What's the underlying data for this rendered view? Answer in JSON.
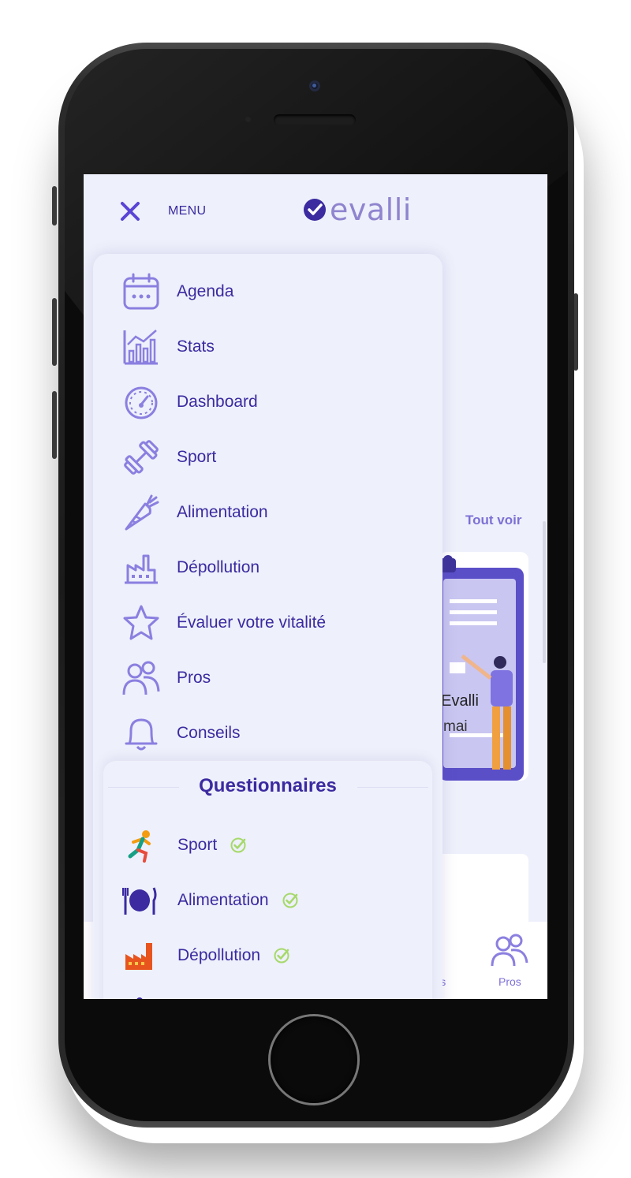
{
  "header": {
    "menu_label": "MENU",
    "logo_text": "evalli"
  },
  "menu": {
    "items": [
      {
        "label": "Agenda",
        "icon": "calendar-icon"
      },
      {
        "label": "Stats",
        "icon": "stats-chart-icon"
      },
      {
        "label": "Dashboard",
        "icon": "gauge-icon"
      },
      {
        "label": "Sport",
        "icon": "dumbbell-icon"
      },
      {
        "label": "Alimentation",
        "icon": "carrot-icon"
      },
      {
        "label": "Dépollution",
        "icon": "factory-icon"
      },
      {
        "label": "Évaluer votre vitalité",
        "icon": "star-icon"
      },
      {
        "label": "Pros",
        "icon": "users-icon"
      },
      {
        "label": "Conseils",
        "icon": "bell-icon"
      }
    ]
  },
  "questionnaires": {
    "title": "Questionnaires",
    "items": [
      {
        "label": "Sport",
        "icon": "runner-icon",
        "completed": true
      },
      {
        "label": "Alimentation",
        "icon": "plate-cutlery-icon",
        "completed": true
      },
      {
        "label": "Dépollution",
        "icon": "factory-color-icon",
        "completed": true
      }
    ]
  },
  "background": {
    "see_all": "Tout voir",
    "card_text_1": "nEvalli",
    "card_text_2": "mai",
    "tabs": [
      {
        "label": "ils",
        "icon": "bell-icon"
      },
      {
        "label": "Pros",
        "icon": "users-icon"
      }
    ]
  },
  "colors": {
    "primary": "#3b2aa0",
    "accent": "#7d70d6",
    "icon_stroke": "#8b7fe0",
    "check": "#a6d96a",
    "screen_bg": "#eef0fb"
  }
}
